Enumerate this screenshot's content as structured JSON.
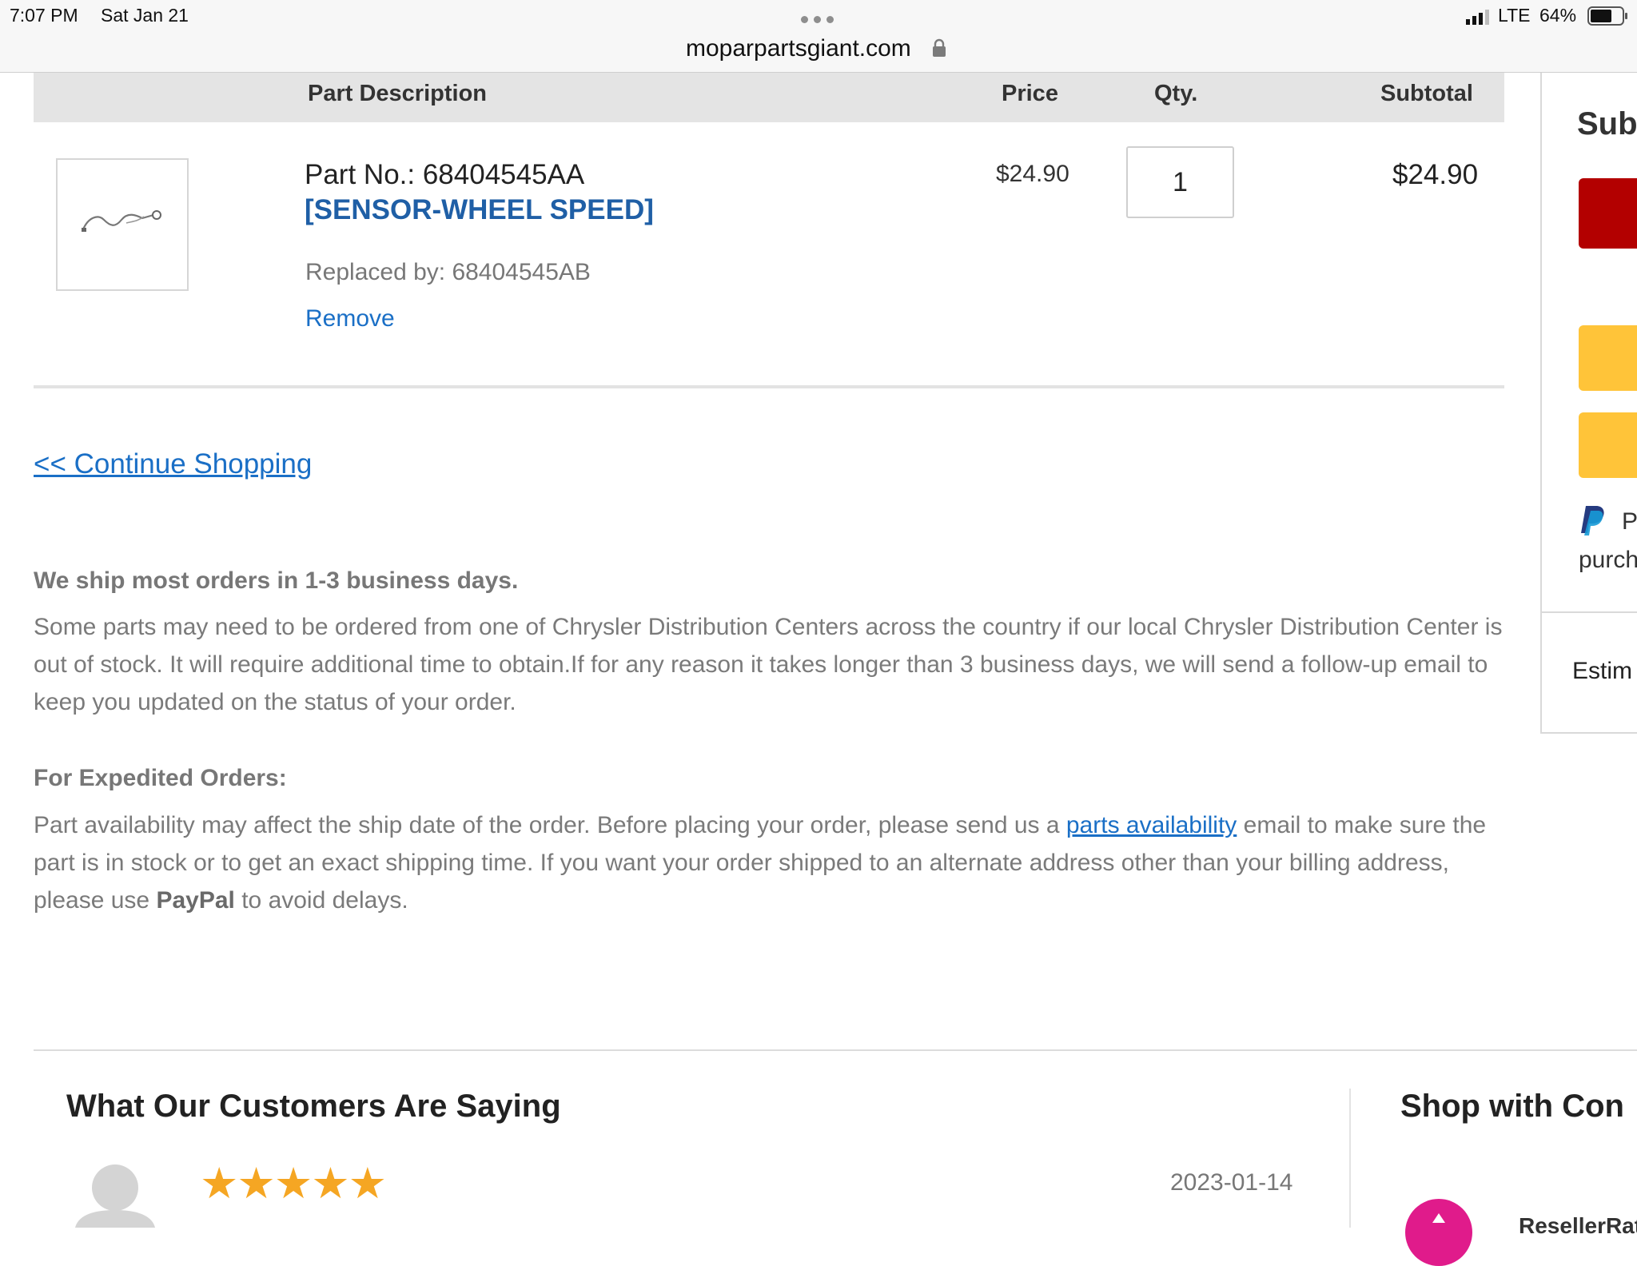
{
  "status_bar": {
    "time": "7:07 PM",
    "date": "Sat Jan 21",
    "network": "LTE",
    "battery": "64%"
  },
  "browser": {
    "url": "moparpartsgiant.com"
  },
  "table": {
    "headers": {
      "description": "Part Description",
      "price": "Price",
      "qty": "Qty.",
      "subtotal": "Subtotal"
    },
    "item": {
      "part_no": "Part No.: 68404545AA",
      "name": "[SENSOR-WHEEL SPEED]",
      "replaced_by": "Replaced by: 68404545AB",
      "remove_label": "Remove",
      "price": "$24.90",
      "qty": "1",
      "subtotal": "$24.90"
    }
  },
  "continue_shopping": "<< Continue Shopping",
  "shipping": {
    "heading": "We ship most orders in 1-3 business days.",
    "text": "Some parts may need to be ordered from one of Chrysler Distribution Centers across the country if our local Chrysler Distribution Center is out of stock. It will require additional time to obtain.If for any reason it takes longer than 3 business days, we will send a follow-up email to keep you updated on the status of your order."
  },
  "expedited": {
    "heading": "For Expedited Orders:",
    "text_before_link": "Part availability may affect the ship date of the order. Before placing your order, please send us a ",
    "link": "parts availability",
    "text_after_link": " email to make sure the part is in stock or to get an exact shipping time. If you want your order shipped to an alternate address other than your billing address, please use ",
    "paypal_bold": "PayPal",
    "text_end": " to avoid delays."
  },
  "summary_panel": {
    "title_partial": "Sub",
    "paypal_partial": "P",
    "purchase_partial": "purch",
    "estimate_partial": "Estim",
    "colors": {
      "checkout": "#b30000",
      "paypal_buttons": "#ffc439"
    }
  },
  "reviews": {
    "heading": "What Our Customers Are Saying",
    "date": "2023-01-14",
    "stars": "★★★★★",
    "rating": 5
  },
  "shop_with": {
    "heading_partial": "Shop with Con",
    "badge_partial": "ResellerRat"
  }
}
